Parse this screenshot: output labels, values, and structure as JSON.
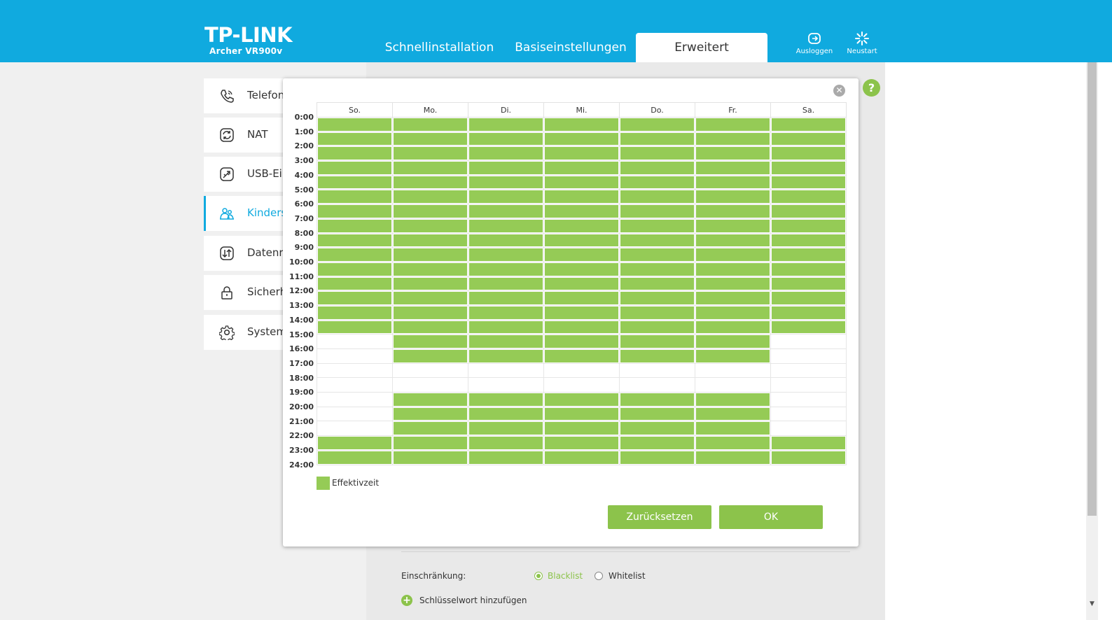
{
  "header": {
    "brand": "TP-LINK",
    "model": "Archer VR900v",
    "tabs": [
      "Schnellinstallation",
      "Basiseinstellungen",
      "Erweitert"
    ],
    "active_tab": "Erweitert",
    "logout_label": "Ausloggen",
    "reboot_label": "Neustart",
    "background_color": "#10aadf"
  },
  "sidebar": {
    "items": [
      {
        "label": "Telefoni",
        "icon": "phone-icon"
      },
      {
        "label": "NAT",
        "icon": "nat-icon"
      },
      {
        "label": "USB-Ei",
        "icon": "usb-icon"
      },
      {
        "label": "Kinders",
        "icon": "parental-icon",
        "active": true
      },
      {
        "label": "Datenra",
        "icon": "data-transfer-icon"
      },
      {
        "label": "Sicherh",
        "icon": "lock-icon"
      },
      {
        "label": "System",
        "icon": "gear-icon"
      }
    ]
  },
  "help_label": "?",
  "schedule": {
    "days": [
      "So.",
      "Mo.",
      "Di.",
      "Mi.",
      "Do.",
      "Fr.",
      "Sa."
    ],
    "hours": [
      "0:00",
      "1:00",
      "2:00",
      "3:00",
      "4:00",
      "5:00",
      "6:00",
      "7:00",
      "8:00",
      "9:00",
      "10:00",
      "11:00",
      "12:00",
      "13:00",
      "14:00",
      "15:00",
      "16:00",
      "17:00",
      "18:00",
      "19:00",
      "20:00",
      "21:00",
      "22:00",
      "23:00",
      "24:00"
    ],
    "effective": [
      [
        1,
        1,
        1,
        1,
        1,
        1,
        1,
        1,
        1,
        1,
        1,
        1,
        1,
        1,
        1,
        0,
        0,
        0,
        0,
        0,
        0,
        0,
        1,
        1
      ],
      [
        1,
        1,
        1,
        1,
        1,
        1,
        1,
        1,
        1,
        1,
        1,
        1,
        1,
        1,
        1,
        1,
        1,
        0,
        0,
        1,
        1,
        1,
        1,
        1
      ],
      [
        1,
        1,
        1,
        1,
        1,
        1,
        1,
        1,
        1,
        1,
        1,
        1,
        1,
        1,
        1,
        1,
        1,
        0,
        0,
        1,
        1,
        1,
        1,
        1
      ],
      [
        1,
        1,
        1,
        1,
        1,
        1,
        1,
        1,
        1,
        1,
        1,
        1,
        1,
        1,
        1,
        1,
        1,
        0,
        0,
        1,
        1,
        1,
        1,
        1
      ],
      [
        1,
        1,
        1,
        1,
        1,
        1,
        1,
        1,
        1,
        1,
        1,
        1,
        1,
        1,
        1,
        1,
        1,
        0,
        0,
        1,
        1,
        1,
        1,
        1
      ],
      [
        1,
        1,
        1,
        1,
        1,
        1,
        1,
        1,
        1,
        1,
        1,
        1,
        1,
        1,
        1,
        1,
        1,
        0,
        0,
        1,
        1,
        1,
        1,
        1
      ],
      [
        1,
        1,
        1,
        1,
        1,
        1,
        1,
        1,
        1,
        1,
        1,
        1,
        1,
        1,
        1,
        0,
        0,
        0,
        0,
        0,
        0,
        0,
        1,
        1
      ]
    ],
    "fill_color": "#95cb56",
    "legend_label": "Effektivzeit",
    "reset_label": "Zurücksetzen",
    "ok_label": "OK"
  },
  "form": {
    "restriction_label": "Einschränkung:",
    "blacklist_label": "Blacklist",
    "whitelist_label": "Whitelist",
    "selected": "Blacklist",
    "add_keyword_label": "Schlüsselwort hinzufügen"
  }
}
